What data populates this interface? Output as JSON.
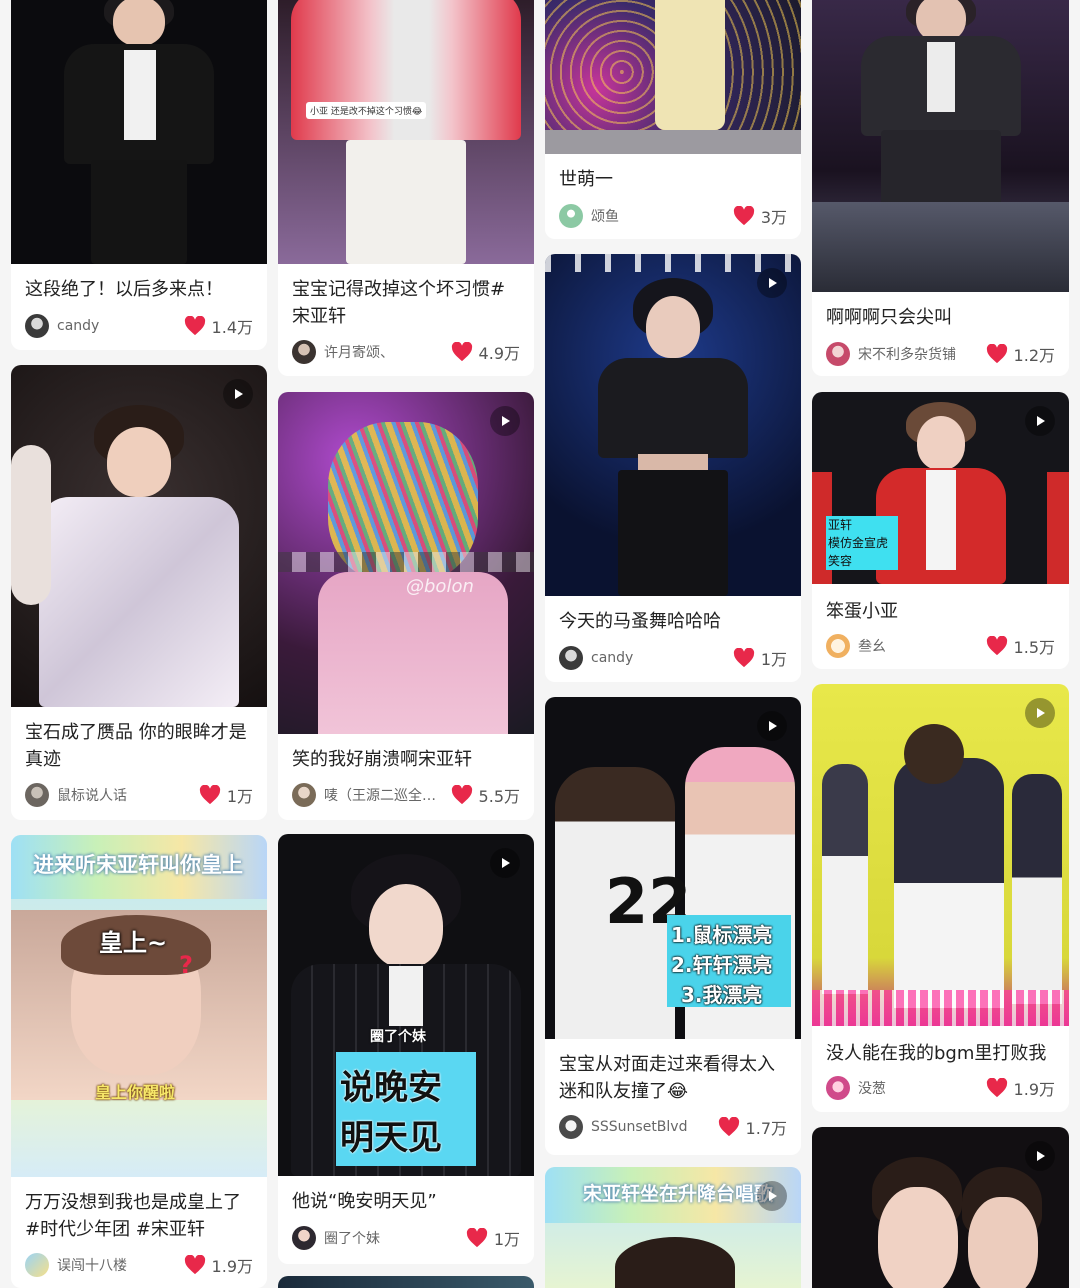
{
  "colors": {
    "heart": "#e8284a",
    "background": "#f5f5f5"
  },
  "icons": {
    "heart": "heart-icon",
    "play": "play-icon"
  },
  "cards": [
    {
      "id": "c1",
      "title": "这段绝了！以后多来点！",
      "author": "candy",
      "likes": "1.4万"
    },
    {
      "id": "c2",
      "title": "宝宝记得改掉这个坏习惯#宋亚轩",
      "author": "许月寄颂、",
      "likes": "4.9万",
      "overlay": "小亚 还是改不掉这个习惯😂"
    },
    {
      "id": "c3",
      "title": "世萌一",
      "author": "颂鱼",
      "likes": "3万"
    },
    {
      "id": "c4",
      "title": "啊啊啊只会尖叫",
      "author": "宋不利多杂货铺",
      "likes": "1.2万"
    },
    {
      "id": "c5",
      "title": "宝石成了赝品 你的眼眸才是真迹",
      "author": "鼠标说人话",
      "likes": "1万"
    },
    {
      "id": "c6",
      "title": "笑的我好崩溃啊宋亚轩",
      "author": "唛（王源二巡全…",
      "likes": "5.5万",
      "watermark": "@bolon"
    },
    {
      "id": "c7",
      "title": "今天的马蚤舞哈哈哈",
      "author": "candy",
      "likes": "1万"
    },
    {
      "id": "c8",
      "title": "笨蛋小亚",
      "author": "叁幺",
      "likes": "1.5万",
      "overlay_lines": [
        "亚轩",
        "模仿金宣虎",
        "笑容"
      ]
    },
    {
      "id": "c9",
      "title": "万万没想到我也是成皇上了 #时代少年团 #宋亚轩",
      "author": "误闯十八楼",
      "likes": "1.9万",
      "banner": "进来听宋亚轩叫你皇上",
      "overlay_top": "皇上~",
      "overlay_bottom": "皇上你醒啦"
    },
    {
      "id": "c10",
      "title": "他说“晚安明天见”",
      "author": "圈了个妹",
      "likes": "1万",
      "overlay_small": "圈了个妹",
      "overlay_big": [
        "说晚安",
        "明天见"
      ]
    },
    {
      "id": "c11",
      "title": "宝宝从对面走过来看得太入迷和队友撞了😂",
      "author": "SSSunsetBlvd",
      "likes": "1.7万",
      "overlay_lines": [
        "1.鼠标漂亮",
        "2.轩轩漂亮",
        "3.我漂亮"
      ],
      "jersey": "22"
    },
    {
      "id": "c12",
      "title": "没人能在我的bgm里打败我",
      "author": "没葱",
      "likes": "1.9万"
    },
    {
      "id": "c13",
      "banner": "宋亚轩坐在升降台唱歌"
    }
  ]
}
